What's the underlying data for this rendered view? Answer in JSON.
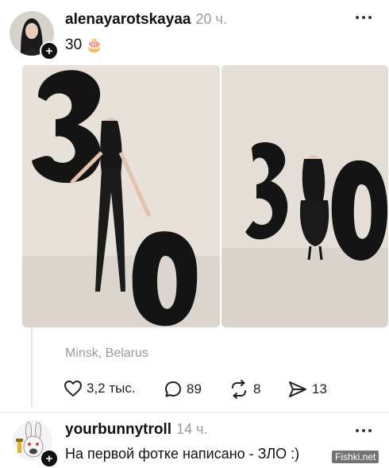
{
  "post": {
    "username": "alenayarotskayaa",
    "time": "20 ч.",
    "text": "30",
    "emoji": "🎂",
    "location": "Minsk, Belarus",
    "actions": {
      "likes": "3,2 тыс.",
      "comments": "89",
      "reposts": "8",
      "shares": "13"
    }
  },
  "reply": {
    "username": "yourbunnytroll",
    "time": "14 ч.",
    "text": "На первой фотке написано - ЗЛО :)"
  },
  "watermark": "Fishki.net",
  "icons": {
    "more": "more-icon",
    "follow": "plus-icon",
    "like": "heart-icon",
    "comment": "comment-icon",
    "repost": "repost-icon",
    "share": "share-icon"
  }
}
